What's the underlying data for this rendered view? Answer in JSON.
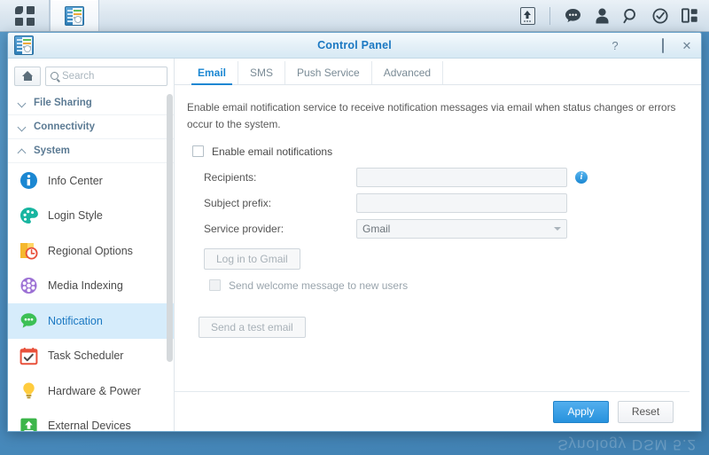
{
  "taskbar": {
    "menu_icon": "app-grid-icon",
    "app_button_icon": "control-panel-icon",
    "tray": [
      {
        "icon": "upload-icon",
        "name": "upload-queue-icon"
      },
      {
        "icon": "●●●",
        "name": "notifications-icon"
      },
      {
        "icon": "♟",
        "name": "user-options-icon"
      },
      {
        "icon": "⚲",
        "name": "search-icon"
      },
      {
        "icon": "✓",
        "name": "help-icon"
      },
      {
        "icon": "▧",
        "name": "widgets-icon"
      }
    ]
  },
  "desktop": {
    "watermark": "Synology DSM 5.2"
  },
  "window": {
    "title": "Control Panel",
    "controls": {
      "help": "?",
      "minimize": "minimize-icon",
      "maximize": "maximize-icon",
      "close": "✕"
    }
  },
  "sidebar": {
    "home_label": "Home",
    "search": {
      "value": "",
      "placeholder": "Search"
    },
    "groups": [
      {
        "label": "File Sharing",
        "expanded": false
      },
      {
        "label": "Connectivity",
        "expanded": false
      },
      {
        "label": "System",
        "expanded": true
      }
    ],
    "items": [
      {
        "label": "Info Center",
        "icon": "info-center-icon",
        "selected": false
      },
      {
        "label": "Login Style",
        "icon": "login-style-icon",
        "selected": false
      },
      {
        "label": "Regional Options",
        "icon": "regional-options-icon",
        "selected": false
      },
      {
        "label": "Media Indexing",
        "icon": "media-indexing-icon",
        "selected": false
      },
      {
        "label": "Notification",
        "icon": "notification-icon",
        "selected": true
      },
      {
        "label": "Task Scheduler",
        "icon": "task-scheduler-icon",
        "selected": false
      },
      {
        "label": "Hardware & Power",
        "icon": "hardware-power-icon",
        "selected": false
      },
      {
        "label": "External Devices",
        "icon": "external-devices-icon",
        "selected": false
      }
    ]
  },
  "main": {
    "tabs": [
      {
        "label": "Email",
        "active": true
      },
      {
        "label": "SMS",
        "active": false
      },
      {
        "label": "Push Service",
        "active": false
      },
      {
        "label": "Advanced",
        "active": false
      }
    ],
    "intro": "Enable email notification service to receive notification messages via email when status changes or errors occur to the system.",
    "enable_checkbox": {
      "label": "Enable email notifications",
      "checked": false
    },
    "fields": {
      "recipients": {
        "label": "Recipients:",
        "value": "",
        "placeholder": ""
      },
      "subject_prefix": {
        "label": "Subject prefix:",
        "value": "",
        "placeholder": ""
      },
      "service_provider": {
        "label": "Service provider:",
        "value": "Gmail"
      }
    },
    "login_button": "Log in to Gmail",
    "welcome_checkbox": {
      "label": "Send welcome message to new users",
      "checked": false
    },
    "test_email_button": "Send a test email"
  },
  "footer": {
    "apply_label": "Apply",
    "reset_label": "Reset"
  },
  "colors": {
    "accent": "#1b87d2",
    "primary_button": "#2792dd",
    "selected_row": "#d6ecfb",
    "desktop": "#4a8cbe"
  }
}
